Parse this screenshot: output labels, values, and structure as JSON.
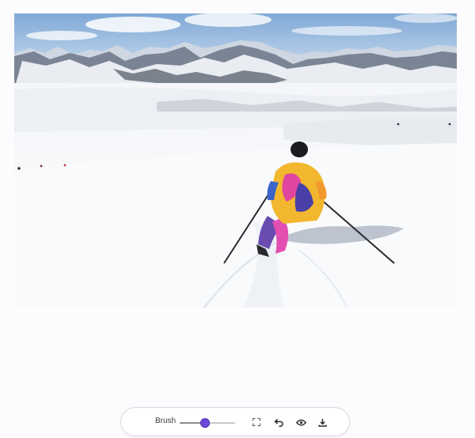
{
  "toolbar": {
    "brush_label": "Brush",
    "brush_size": 0.45,
    "accent_color": "#6b48d8",
    "icons": [
      "expand-icon",
      "undo-icon",
      "eye-icon",
      "download-icon"
    ]
  }
}
